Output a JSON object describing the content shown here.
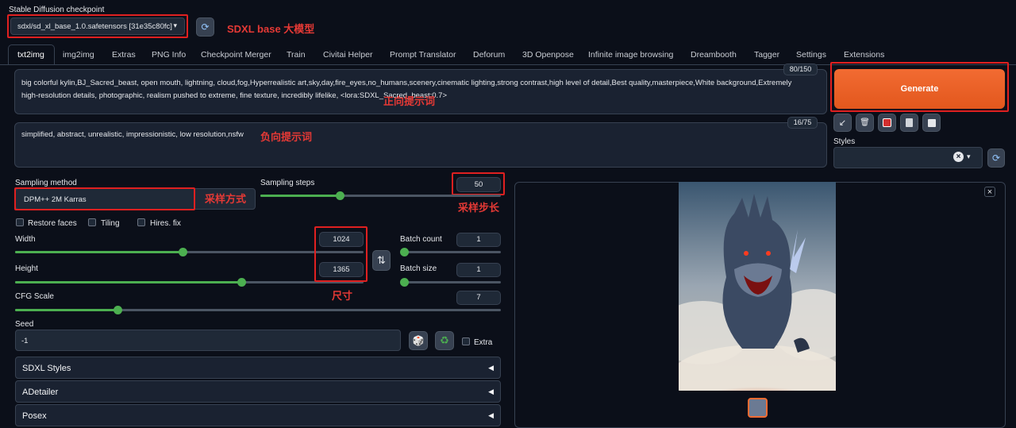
{
  "checkpoint": {
    "label": "Stable Diffusion checkpoint",
    "value": "sdxl/sd_xl_base_1.0.safetensors [31e35c80fc]",
    "annotation": "SDXL base 大模型"
  },
  "tabs": [
    "txt2img",
    "img2img",
    "Extras",
    "PNG Info",
    "Checkpoint Merger",
    "Train",
    "Civitai Helper",
    "Prompt Translator",
    "Deforum",
    "3D Openpose",
    "Infinite image browsing",
    "Dreambooth",
    "Tagger",
    "Settings",
    "Extensions"
  ],
  "prompt": {
    "text": "big colorful kylin,BJ_Sacred_beast, open mouth, lightning, cloud,fog,Hyperrealistic art,sky,day,fire_eyes,no_humans,scenery,cinematic lighting,strong contrast,high level of detail,Best quality,masterpiece,White background,Extremely high-resolution details, photographic, realism pushed to extreme, fine texture, incredibly lifelike, <lora:SDXL_Sacred_beast:0.7>",
    "counter": "80/150",
    "annotation": "正向提示词"
  },
  "negative": {
    "text": "simplified, abstract, unrealistic, impressionistic, low resolution,nsfw",
    "counter": "16/75",
    "annotation": "负向提示词"
  },
  "generate_label": "Generate",
  "styles": {
    "label": "Styles",
    "clear": "×",
    "arrow": "▾"
  },
  "sampling": {
    "method_label": "Sampling method",
    "method_value": "DPM++ 2M Karras",
    "method_annotation": "采样方式",
    "steps_label": "Sampling steps",
    "steps_value": "50",
    "steps_annotation": "采样步长",
    "steps_fraction": 0.33
  },
  "options": {
    "restore_faces": "Restore faces",
    "tiling": "Tiling",
    "hires": "Hires. fix"
  },
  "size": {
    "width_label": "Width",
    "width_value": "1024",
    "width_fraction": 0.48,
    "height_label": "Height",
    "height_value": "1365",
    "height_fraction": 0.65,
    "annotation": "尺寸",
    "swap_icon": "⇅"
  },
  "batch": {
    "count_label": "Batch count",
    "count_value": "1",
    "size_label": "Batch size",
    "size_value": "1"
  },
  "cfg": {
    "label": "CFG Scale",
    "value": "7",
    "fraction": 0.21
  },
  "seed": {
    "label": "Seed",
    "value": "-1",
    "extra_label": "Extra",
    "dice": "🎲",
    "recycle": "♻"
  },
  "accordions": [
    "SDXL Styles",
    "ADetailer",
    "Posex"
  ],
  "accordion_arrow": "◀",
  "output": {
    "close": "×"
  },
  "colors": {
    "generate": "#f0642a",
    "accent_green": "#4caf50",
    "annotation_red": "#e53935"
  }
}
